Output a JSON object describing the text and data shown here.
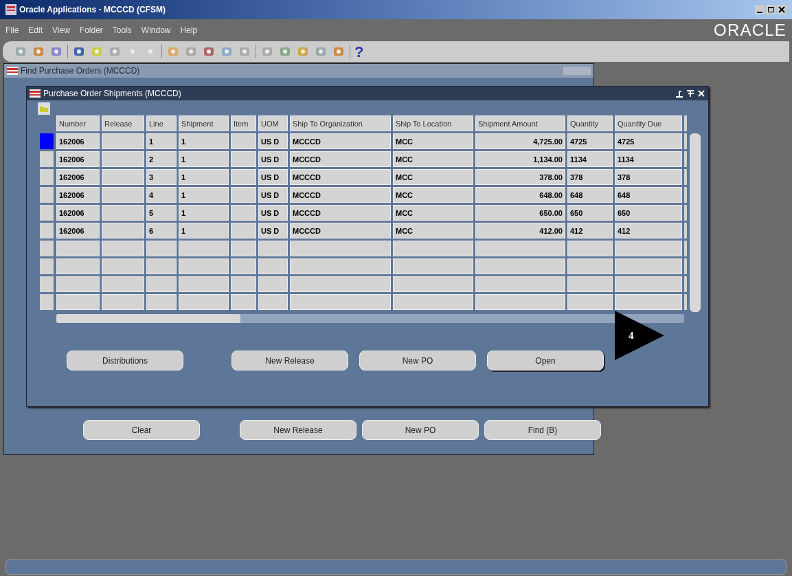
{
  "window": {
    "title": "Oracle Applications - MCCCD (CFSM)"
  },
  "menu": [
    "File",
    "Edit",
    "View",
    "Folder",
    "Tools",
    "Window",
    "Help"
  ],
  "logo": "ORACLE",
  "toolbar": {
    "help": "?"
  },
  "find_window": {
    "title": "Find Purchase Orders (MCCCD)",
    "active": false,
    "buttons": [
      "Clear",
      "New Release",
      "New PO",
      "Find (B)"
    ]
  },
  "shipments_window": {
    "title": "Purchase Order Shipments (MCCCD)",
    "active": true,
    "table": {
      "columns": [
        "Number",
        "Release",
        "Line",
        "Shipment",
        "Item",
        "UOM",
        "Ship To Organization",
        "Ship To Location",
        "Shipment Amount",
        "Quantity",
        "Quantity Due"
      ],
      "rows": [
        {
          "selected": true,
          "cells": [
            "162006",
            "",
            "1",
            "1",
            "",
            "US D",
            "MCCCD",
            "MCC",
            "4,725.00",
            "4725",
            "4725"
          ]
        },
        {
          "selected": false,
          "cells": [
            "162006",
            "",
            "2",
            "1",
            "",
            "US D",
            "MCCCD",
            "MCC",
            "1,134.00",
            "1134",
            "1134"
          ]
        },
        {
          "selected": false,
          "cells": [
            "162006",
            "",
            "3",
            "1",
            "",
            "US D",
            "MCCCD",
            "MCC",
            "378.00",
            "378",
            "378"
          ]
        },
        {
          "selected": false,
          "cells": [
            "162006",
            "",
            "4",
            "1",
            "",
            "US D",
            "MCCCD",
            "MCC",
            "648.00",
            "648",
            "648"
          ]
        },
        {
          "selected": false,
          "cells": [
            "162006",
            "",
            "5",
            "1",
            "",
            "US D",
            "MCCCD",
            "MCC",
            "650.00",
            "650",
            "650"
          ]
        },
        {
          "selected": false,
          "cells": [
            "162006",
            "",
            "6",
            "1",
            "",
            "US D",
            "MCCCD",
            "MCC",
            "412.00",
            "412",
            "412"
          ]
        }
      ]
    },
    "buttons": [
      "Distributions",
      "New Release",
      "New PO",
      "Open"
    ]
  },
  "callout": {
    "label": "4"
  }
}
